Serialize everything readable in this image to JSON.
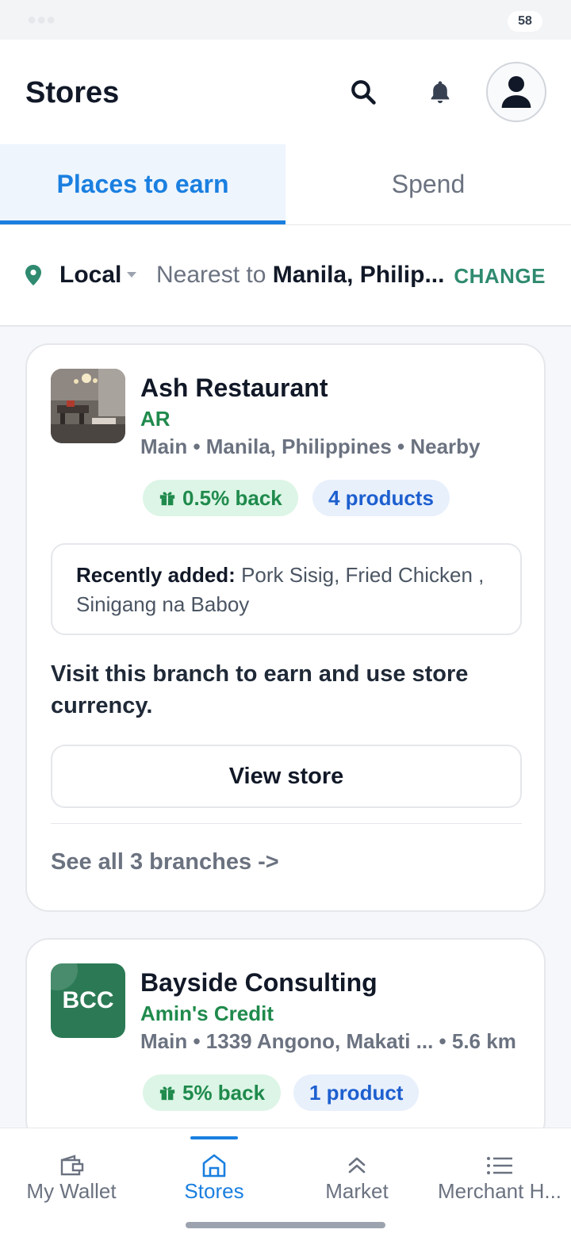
{
  "status": {
    "battery": "58"
  },
  "header": {
    "title": "Stores"
  },
  "tabs": [
    {
      "label": "Places to earn",
      "active": true
    },
    {
      "label": "Spend",
      "active": false
    }
  ],
  "location": {
    "mode": "Local",
    "prefix": "Nearest to",
    "place": "Manila, Philip...",
    "change_label": "CHANGE"
  },
  "stores": [
    {
      "name": "Ash Restaurant",
      "currency": "AR",
      "meta": "Main • Manila, Philippines • Nearby",
      "cashback": "0.5% back",
      "products": "4 products",
      "recent_label": "Recently added:",
      "recent_items": "Pork Sisig, Fried Chicken , Sinigang na Baboy",
      "visit_note": "Visit this branch to earn and use store currency.",
      "view_store_label": "View store",
      "see_all_label": "See all 3 branches ->"
    },
    {
      "name": "Bayside Consulting",
      "logo_text": "BCC",
      "currency": "Amin's Credit",
      "meta": "Main • 1339 Angono, Makati ... • 5.6 km",
      "cashback": "5% back",
      "products": "1 product"
    }
  ],
  "bottom_nav": [
    {
      "label": "My Wallet",
      "icon": "wallet-icon"
    },
    {
      "label": "Stores",
      "icon": "store-icon",
      "active": true
    },
    {
      "label": "Market",
      "icon": "market-icon"
    },
    {
      "label": "Merchant H...",
      "icon": "list-icon"
    }
  ],
  "colors": {
    "accent": "#1a7fe0",
    "green": "#1f8a4c",
    "change": "#2f8a6f"
  }
}
